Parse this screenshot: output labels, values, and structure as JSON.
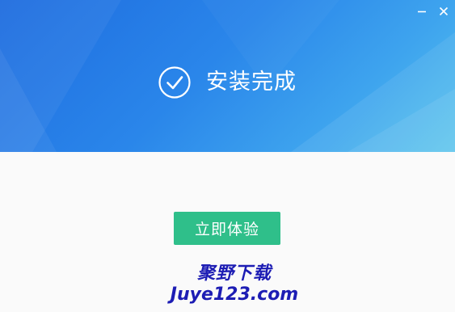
{
  "window": {
    "minimize_icon": "minimize-icon",
    "close_icon": "close-icon"
  },
  "banner": {
    "status_icon": "check-circle-icon",
    "status_text": "安装完成",
    "gradient_colors": [
      "#1e6cdf",
      "#3ea4ee",
      "#56c3ec"
    ]
  },
  "actions": {
    "launch_label": "立即体验",
    "launch_color": "#2fbf8a"
  },
  "watermark": {
    "line1": "聚野下载",
    "line2": "Juye123.com",
    "color": "#1d1db4"
  }
}
